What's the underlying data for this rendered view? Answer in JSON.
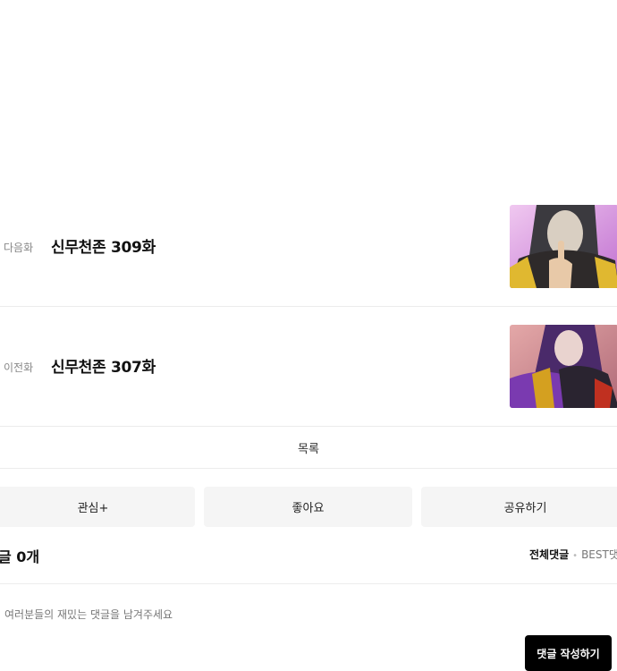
{
  "episodes": {
    "next": {
      "tag": "다음화",
      "title": "신무천존 309화"
    },
    "prev": {
      "tag": "이전화",
      "title": "신무천존 307화"
    }
  },
  "list_label": "목록",
  "actions": {
    "favorite": "관심+",
    "like": "좋아요",
    "share": "공유하기"
  },
  "comments": {
    "count_label": "글 0개",
    "sort_all": "전체댓글",
    "sort_best": "BEST댓",
    "placeholder": "여러분들의 재밌는 댓글을 남겨주세요",
    "write_button": "댓글 작성하기"
  }
}
